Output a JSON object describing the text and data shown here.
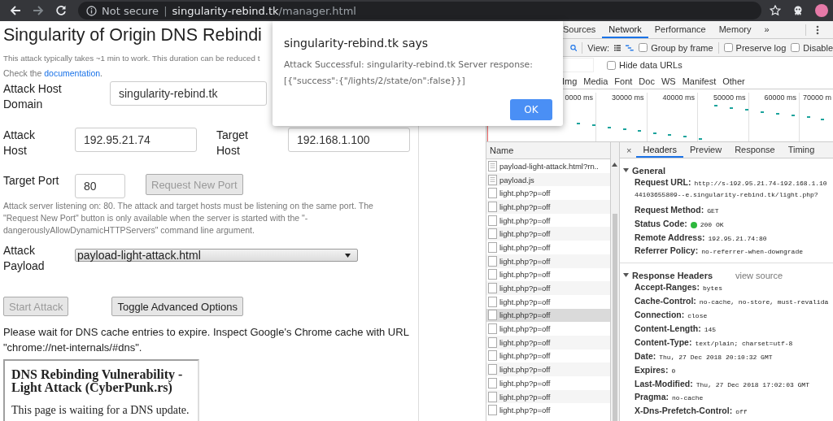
{
  "browser": {
    "security_label": "Not secure",
    "separator": "|",
    "url_host": "singularity-rebind.tk",
    "url_path": "/manager.html"
  },
  "page": {
    "title": "Singularity of Origin DNS Rebindi",
    "intro": "This attack typically takes ~1 min to work. This duration can be reduced t",
    "doc_note": {
      "before": "Check the ",
      "link": "documentation",
      "after": "."
    },
    "attack_host_domain": {
      "label": "Attack Host Domain",
      "value": "singularity-rebind.tk"
    },
    "attack_host": {
      "label": "Attack Host",
      "value": "192.95.21.74"
    },
    "target_host": {
      "label": "Target Host",
      "value": "192.168.1.100"
    },
    "target_port": {
      "label": "Target Port",
      "value": "80"
    },
    "request_port_button": {
      "label": "Request New Port",
      "disabled": true
    },
    "port_help": "Attack server listening on: 80. The attack and target hosts must be listening on the same port. The \"Request New Port\" button is only available when the server is started with the \"-dangerouslyAllowDynamicHTTPServers\" command line argument.",
    "attack_payload": {
      "label": "Attack Payload",
      "value": "payload-light-attack.html"
    },
    "start_button": {
      "label": "Start Attack",
      "disabled": true
    },
    "advanced_button": {
      "label": "Toggle Advanced Options",
      "disabled": false
    },
    "wait_note": "Please wait for DNS cache entries to expire. Inspect Google's Chrome cache with URL \"chrome://net-internals/#dns\".",
    "frame": {
      "heading": "DNS Rebinding Vulnerability - Light Attack (CyberPunk.rs)",
      "text": "This page is waiting for a DNS update."
    }
  },
  "dialog": {
    "title": "singularity-rebind.tk says",
    "message": "Attack Successful: singularity-rebind.tk Server response: [{\"success\":{\"/lights/2/state/on\":false}}]",
    "button": "OK"
  },
  "devtools": {
    "tabs": [
      {
        "label": "Sources",
        "selected": false
      },
      {
        "label": "Network",
        "selected": true
      },
      {
        "label": "Performance",
        "selected": false
      },
      {
        "label": "Memory",
        "selected": false
      }
    ],
    "more_tabs": "»",
    "view_label": "View:",
    "options": [
      {
        "label": "Group by frame",
        "checked": false
      },
      {
        "label": "Preserve log",
        "checked": false
      },
      {
        "label": "Disable",
        "checked": false
      }
    ],
    "hide_data_urls": {
      "label": "Hide data URLs",
      "checked": false
    },
    "type_filters": [
      "Img",
      "Media",
      "Font",
      "Doc",
      "WS",
      "Manifest",
      "Other"
    ],
    "timeline_ticks": [
      "0000 ms",
      "30000 ms",
      "40000 ms",
      "50000 ms",
      "60000 ms",
      "70000 m"
    ],
    "requests": {
      "column": "Name",
      "rows": [
        {
          "name": "payload-light-attack.html?rn..",
          "kind": "document",
          "selected": false
        },
        {
          "name": "payload.js",
          "kind": "script",
          "selected": false
        },
        {
          "name": "light.php?p=off",
          "kind": "xhr",
          "selected": false
        },
        {
          "name": "light.php?p=off",
          "kind": "xhr",
          "selected": false
        },
        {
          "name": "light.php?p=off",
          "kind": "xhr",
          "selected": false
        },
        {
          "name": "light.php?p=off",
          "kind": "xhr",
          "selected": false
        },
        {
          "name": "light.php?p=off",
          "kind": "xhr",
          "selected": false
        },
        {
          "name": "light.php?p=off",
          "kind": "xhr",
          "selected": false
        },
        {
          "name": "light.php?p=off",
          "kind": "xhr",
          "selected": false
        },
        {
          "name": "light.php?p=off",
          "kind": "xhr",
          "selected": false
        },
        {
          "name": "light.php?p=off",
          "kind": "xhr",
          "selected": false
        },
        {
          "name": "light.php?p=off",
          "kind": "xhr",
          "selected": true
        },
        {
          "name": "light.php?p=off",
          "kind": "xhr",
          "selected": false
        },
        {
          "name": "light.php?p=off",
          "kind": "xhr",
          "selected": false
        },
        {
          "name": "light.php?p=off",
          "kind": "xhr",
          "selected": false
        },
        {
          "name": "light.php?p=off",
          "kind": "xhr",
          "selected": false
        },
        {
          "name": "light.php?p=off",
          "kind": "xhr",
          "selected": false
        },
        {
          "name": "light.php?p=off",
          "kind": "xhr",
          "selected": false
        },
        {
          "name": "light.php?p=off",
          "kind": "xhr",
          "selected": false
        }
      ]
    },
    "detail_close": "×",
    "detail_tabs": [
      {
        "label": "Headers",
        "selected": true
      },
      {
        "label": "Preview",
        "selected": false
      },
      {
        "label": "Response",
        "selected": false
      },
      {
        "label": "Timing",
        "selected": false
      }
    ],
    "general": {
      "title": "General",
      "items": [
        {
          "key": "Request URL:",
          "value": "http://s-192.95.21.74-192.168.1.10",
          "value_2": "44103655809--e.singularity-rebind.tk/light.php?",
          "kind": "text"
        },
        {
          "key": "Request Method:",
          "value": "GET",
          "kind": "text"
        },
        {
          "key": "Status Code:",
          "value": "200 OK",
          "kind": "status"
        },
        {
          "key": "Remote Address:",
          "value": "192.95.21.74:80",
          "kind": "text"
        },
        {
          "key": "Referrer Policy:",
          "value": "no-referrer-when-downgrade",
          "kind": "text"
        }
      ]
    },
    "response_headers": {
      "title": "Response Headers",
      "link": "view source",
      "items": [
        {
          "key": "Accept-Ranges:",
          "value": "bytes",
          "kind": "text"
        },
        {
          "key": "Cache-Control:",
          "value": "no-cache, no-store, must-revalida",
          "kind": "text"
        },
        {
          "key": "Connection:",
          "value": "close",
          "kind": "text"
        },
        {
          "key": "Content-Length:",
          "value": "145",
          "kind": "text"
        },
        {
          "key": "Content-Type:",
          "value": "text/plain; charset=utf-8",
          "kind": "text"
        },
        {
          "key": "Date:",
          "value": "Thu, 27 Dec 2018 20:10:32 GMT",
          "kind": "text"
        },
        {
          "key": "Expires:",
          "value": "0",
          "kind": "text"
        },
        {
          "key": "Last-Modified:",
          "value": "Thu, 27 Dec 2018 17:02:03 GMT",
          "kind": "text"
        },
        {
          "key": "Pragma:",
          "value": "no-cache",
          "kind": "text"
        },
        {
          "key": "X-Dns-Prefetch-Control:",
          "value": "off",
          "kind": "text"
        }
      ]
    }
  }
}
